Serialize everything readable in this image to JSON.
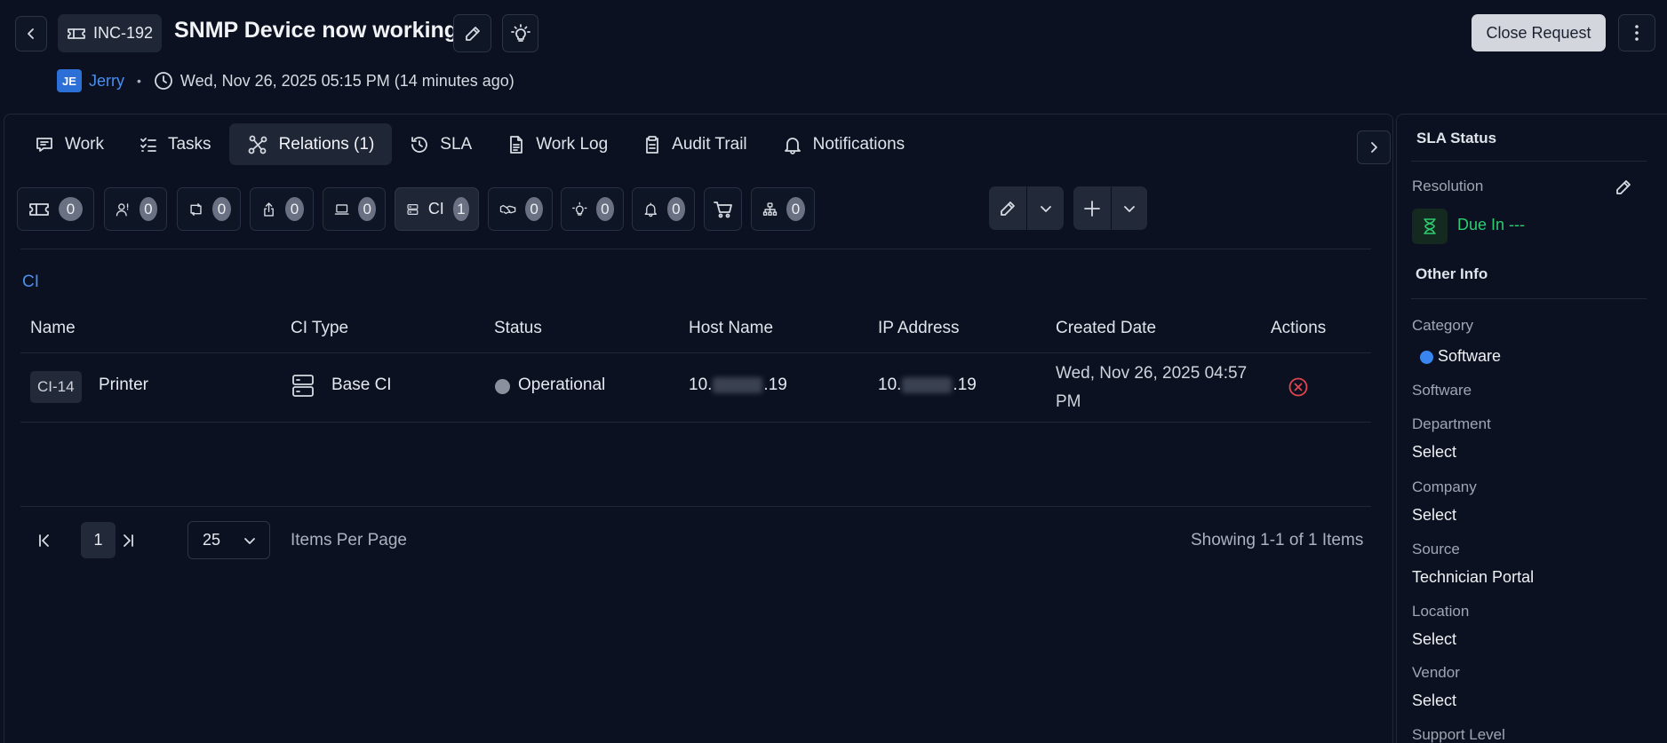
{
  "header": {
    "ticket_id": "INC-192",
    "title": "SNMP Device now working",
    "close_button": "Close Request",
    "user_initials": "JE",
    "user_name": "Jerry",
    "separator": "•",
    "timestamp": "Wed, Nov 26, 2025 05:15 PM (14 minutes ago)"
  },
  "tabs": [
    {
      "label": "Work",
      "icon": "chat-icon"
    },
    {
      "label": "Tasks",
      "icon": "checklist-icon"
    },
    {
      "label": "Relations (1)",
      "icon": "relations-icon",
      "active": true
    },
    {
      "label": "SLA",
      "icon": "history-icon"
    },
    {
      "label": "Work Log",
      "icon": "document-icon"
    },
    {
      "label": "Audit Trail",
      "icon": "clipboard-icon"
    },
    {
      "label": "Notifications",
      "icon": "bell-icon"
    }
  ],
  "relation_chips": [
    {
      "icon": "ticket-icon",
      "count": "0"
    },
    {
      "icon": "user-question-icon",
      "count": "0"
    },
    {
      "icon": "change-icon",
      "count": "0"
    },
    {
      "icon": "release-icon",
      "count": "0"
    },
    {
      "icon": "asset-icon",
      "count": "0"
    },
    {
      "icon": "ci-icon",
      "label": "CI",
      "count": "1",
      "active": true
    },
    {
      "icon": "handshake-icon",
      "count": "0"
    },
    {
      "icon": "bulb-icon",
      "count": "0"
    },
    {
      "icon": "alert-bell-icon",
      "count": "0"
    },
    {
      "icon": "cart-icon",
      "count": ""
    },
    {
      "icon": "hierarchy-icon",
      "count": "0"
    }
  ],
  "section_title": "CI",
  "table": {
    "columns": [
      "Name",
      "CI Type",
      "Status",
      "Host Name",
      "IP Address",
      "Created Date",
      "Actions"
    ],
    "rows": [
      {
        "id": "CI-14",
        "name": "Printer",
        "ci_type": "Base CI",
        "status": "Operational",
        "host_prefix": "10.",
        "host_suffix": ".19",
        "ip_prefix": "10.",
        "ip_suffix": ".19",
        "created": "Wed, Nov 26, 2025 04:57 PM"
      }
    ]
  },
  "pagination": {
    "current_page": "1",
    "per_page": "25",
    "per_page_label": "Items Per Page",
    "showing": "Showing 1-1 of 1 Items"
  },
  "sidebar": {
    "sla_title": "SLA Status",
    "resolution_label": "Resolution",
    "due_text": "Due In ---",
    "other_info_title": "Other Info",
    "fields": [
      {
        "label": "Category",
        "value": "Software"
      },
      {
        "label": "Software",
        "value": ""
      },
      {
        "label": "Department",
        "value": "Select"
      },
      {
        "label": "Company",
        "value": "Select"
      },
      {
        "label": "Source",
        "value": "Technician Portal"
      },
      {
        "label": "Location",
        "value": "Select"
      },
      {
        "label": "Vendor",
        "value": "Select"
      },
      {
        "label": "Support Level",
        "value": ""
      }
    ]
  },
  "colors": {
    "background": "#0b1120",
    "accent_blue": "#4a8ff0",
    "success_green": "#2ecc71",
    "danger_red": "#e0454f"
  }
}
